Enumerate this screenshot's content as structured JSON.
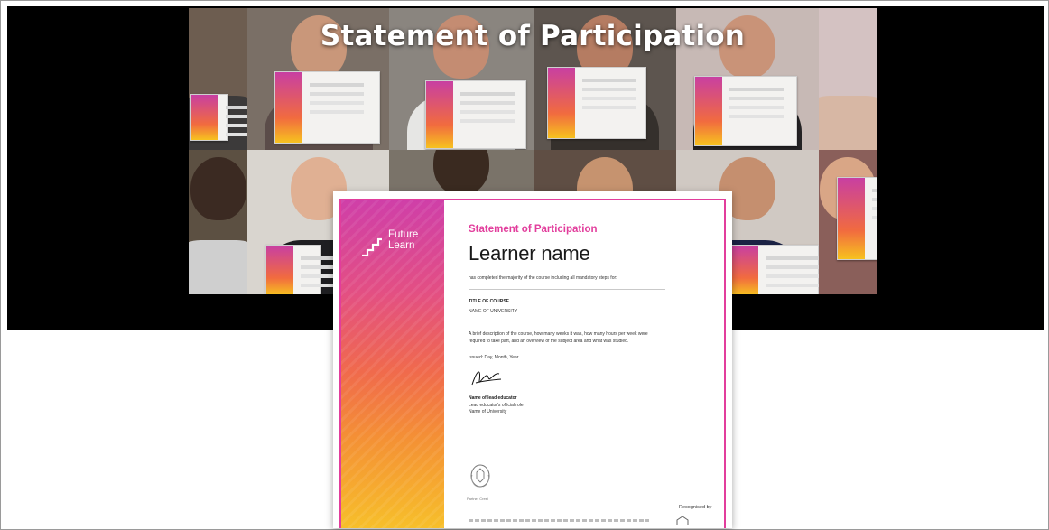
{
  "hero": {
    "title": "Statement of Participation"
  },
  "certificate": {
    "logo_text": "Future\nLearn",
    "heading": "Statement of Participation",
    "learner_name": "Learner name",
    "completion_line": "has completed the majority of the course including all mandatory steps for:",
    "course_title": "TITLE OF COURSE",
    "university": "NAME OF UNIVERSITY",
    "description": "A brief description of the course, how many weeks it was, how many hours per week were required to take part, and an overview of the subject area and what was studied.",
    "issued": "Issued: Day, Month, Year",
    "educator_name": "Name of lead educator",
    "educator_role": "Lead educator's official role",
    "educator_university": "Name of University",
    "crest_caption": "Partner Crest",
    "recognised_by": "Recognised by"
  },
  "colors": {
    "accent_pink": "#e23d9c",
    "gradient": [
      "#cf3fa8",
      "#f06a4c",
      "#f7c02a"
    ]
  }
}
